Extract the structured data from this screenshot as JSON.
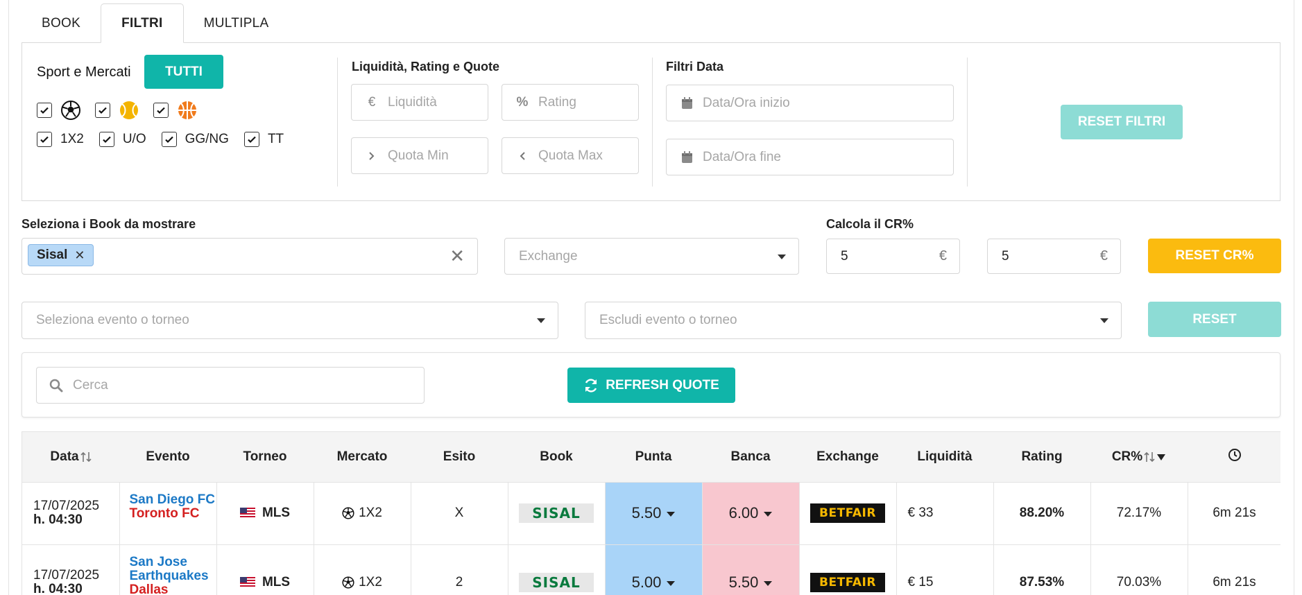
{
  "tabs": [
    {
      "label": "BOOK",
      "active": false
    },
    {
      "label": "FILTRI",
      "active": true
    },
    {
      "label": "MULTIPLA",
      "active": false
    }
  ],
  "filters": {
    "sport_title": "Sport e Mercati",
    "tutti_label": "TUTTI",
    "sports": [
      {
        "icon": "soccer-ball-icon",
        "checked": true
      },
      {
        "icon": "tennis-ball-icon",
        "checked": true
      },
      {
        "icon": "basketball-icon",
        "checked": true
      }
    ],
    "markets": [
      {
        "label": "1X2",
        "checked": true
      },
      {
        "label": "U/O",
        "checked": true
      },
      {
        "label": "GG/NG",
        "checked": true
      },
      {
        "label": "TT",
        "checked": true
      }
    ],
    "liq_title": "Liquidità, Rating e Quote",
    "liquidita_placeholder": "Liquidità",
    "rating_placeholder": "Rating",
    "quota_min_placeholder": "Quota Min",
    "quota_max_placeholder": "Quota Max",
    "date_title": "Filtri Data",
    "data_inizio_placeholder": "Data/Ora inizio",
    "data_fine_placeholder": "Data/Ora fine",
    "reset_filtri_label": "RESET FILTRI"
  },
  "books": {
    "label": "Seleziona i Book da mostrare",
    "selected": [
      "Sisal"
    ],
    "exchange_placeholder": "Exchange"
  },
  "cr": {
    "label": "Calcola il CR%",
    "value1": "5",
    "value2": "5",
    "currency": "€",
    "reset_cr_label": "RESET CR%"
  },
  "events": {
    "select_placeholder": "Seleziona evento o torneo",
    "exclude_placeholder": "Escludi evento o torneo",
    "reset_label": "RESET"
  },
  "search": {
    "placeholder": "Cerca",
    "refresh_label": "REFRESH QUOTE"
  },
  "table": {
    "headers": [
      "Data",
      "Evento",
      "Torneo",
      "Mercato",
      "Esito",
      "Book",
      "Punta",
      "Banca",
      "Exchange",
      "Liquidità",
      "Rating",
      "CR%",
      ""
    ],
    "rows": [
      {
        "date": "17/07/2025",
        "time": "h. 04:30",
        "home": "San Diego FC",
        "away": "Toronto FC",
        "tournament": "MLS",
        "market": "1X2",
        "outcome": "X",
        "book": "SISAL",
        "punta": "5.50",
        "banca": "6.00",
        "exchange": "BETFAIR",
        "liquidity": "€ 33",
        "rating": "88.20%",
        "cr": "72.17%",
        "elapsed": "6m 21s"
      },
      {
        "date": "17/07/2025",
        "time": "h. 04:30",
        "home": "San Jose Earthquakes",
        "away": "Dallas",
        "tournament": "MLS",
        "market": "1X2",
        "outcome": "2",
        "book": "SISAL",
        "punta": "5.00",
        "banca": "5.50",
        "exchange": "BETFAIR",
        "liquidity": "€ 15",
        "rating": "87.53%",
        "cr": "70.03%",
        "elapsed": "6m 21s"
      }
    ]
  },
  "colors": {
    "teal": "#10b5a9",
    "teal_light": "#8ddcd5",
    "yellow": "#fbbb0f",
    "punta_bg": "#a9d4f8",
    "banca_bg": "#f8c7cf",
    "home_team": "#1c79c6",
    "away_team": "#d42020"
  }
}
